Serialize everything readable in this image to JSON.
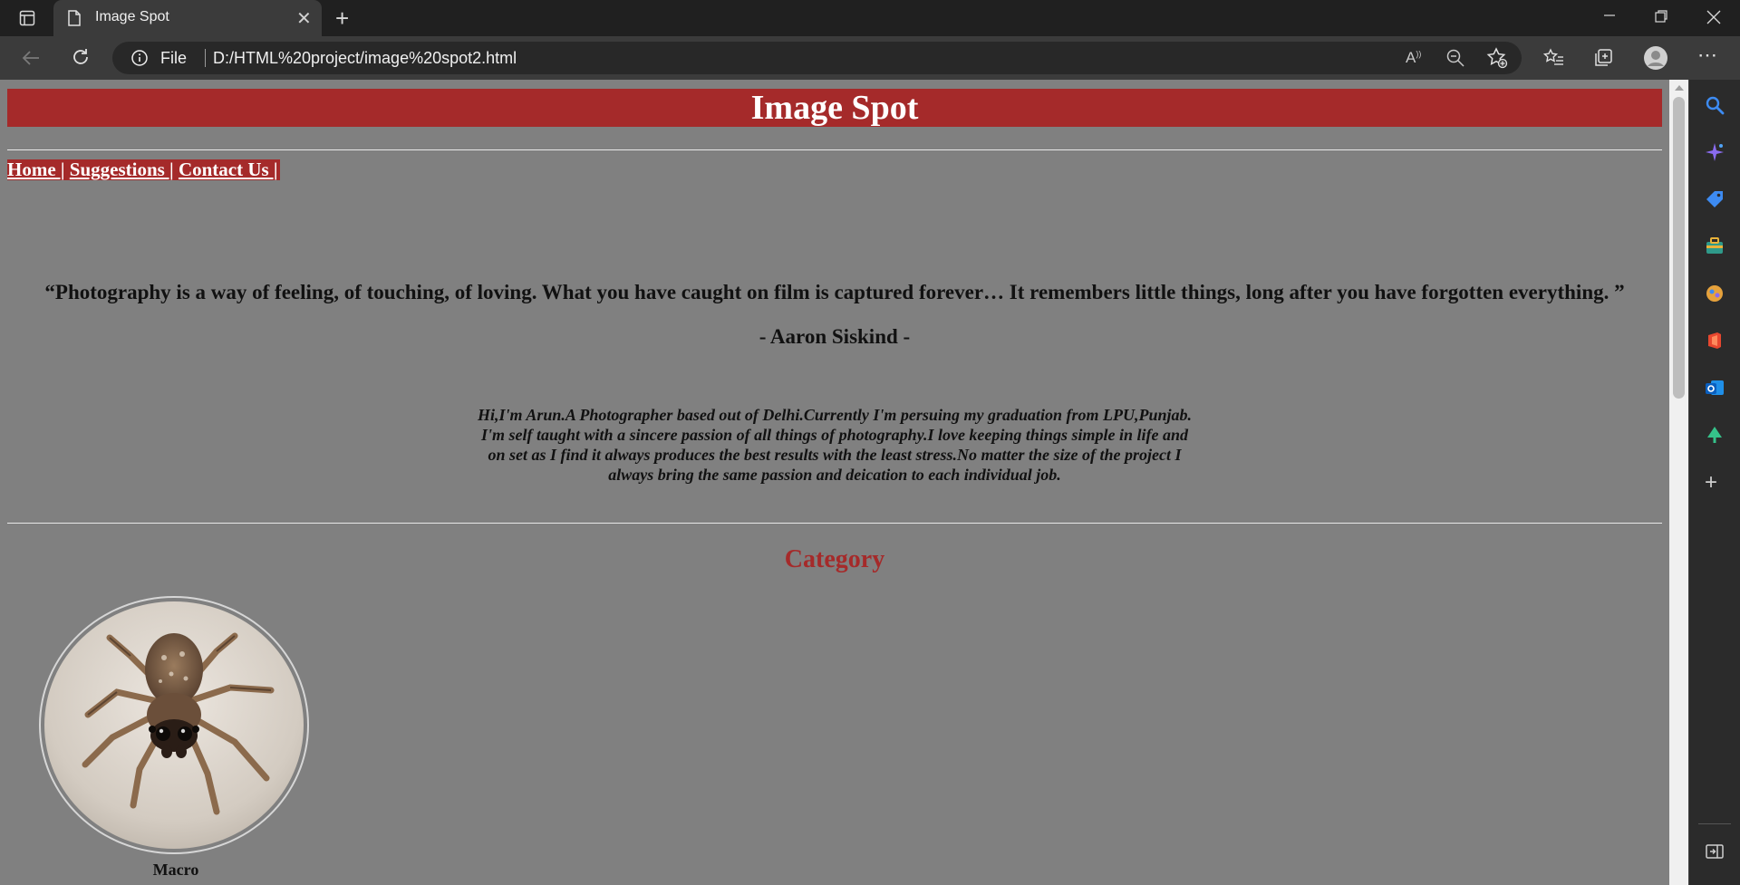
{
  "browser": {
    "tab_title": "Image Spot",
    "address_scheme": "File",
    "address_url": "D:/HTML%20project/image%20spot2.html"
  },
  "page": {
    "header_title": "Image Spot",
    "nav": [
      "Home |",
      "Suggestions |",
      "Contact Us |"
    ],
    "quote": "“Photography is a way of feeling, of touching, of loving. What you have caught on film is captured forever… It remembers little things, long after you have forgotten everything. ”",
    "author": "- Aaron Siskind -",
    "bio_lines": [
      "Hi,I'm Arun.A Photographer based out of Delhi.Currently I'm persuing my graduation from LPU,Punjab.",
      "I'm self taught with a sincere passion of all things of photography.I love keeping things simple in life and",
      "on set as I find it always produces the best results with the least stress.No matter the size of the project I",
      "always bring the same passion and deication to each individual job."
    ],
    "category_heading": "Category",
    "category_card": {
      "label": "Macro",
      "image": "jumping-spider-photo"
    }
  },
  "sidebar_icons": [
    "search-icon",
    "copilot-icon",
    "shopping-tag-icon",
    "tools-icon",
    "games-icon",
    "office-icon",
    "outlook-icon",
    "tree-icon",
    "add-icon",
    "split-screen-icon"
  ],
  "colors": {
    "accent": "#a52a2a",
    "page_bg": "#808080",
    "chrome_dark": "#202020",
    "chrome_toolbar": "#3b3b3b"
  }
}
